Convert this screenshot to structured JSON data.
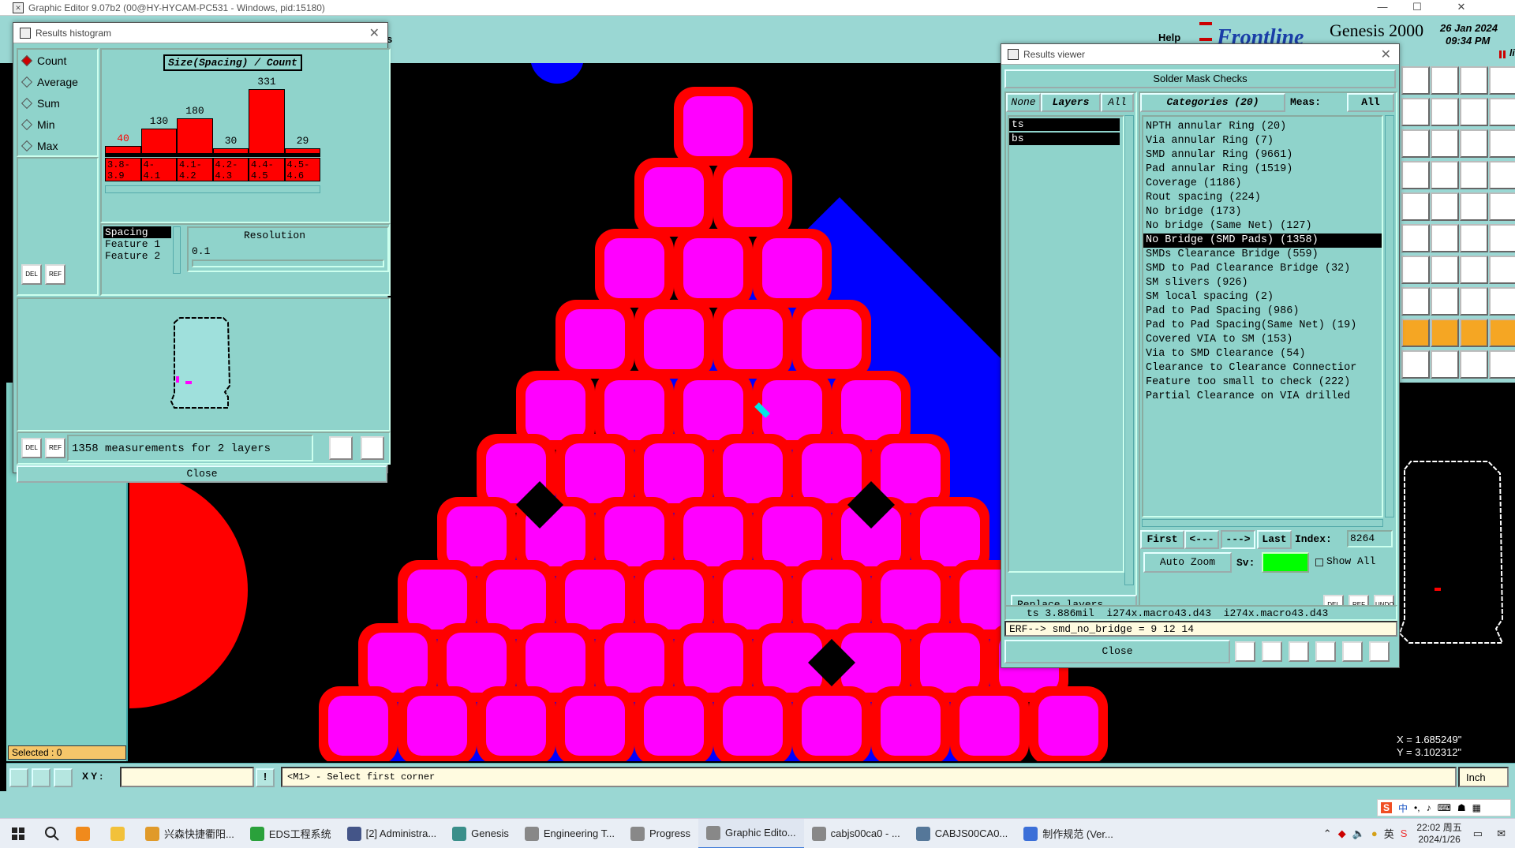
{
  "window": {
    "title": "Graphic Editor 9.07b2 (00@HY-HYCAM-PC531 - Windows, pid:15180)",
    "controls": [
      "—",
      "☐",
      "✕"
    ]
  },
  "brand": {
    "logo_text": "Frontline",
    "product": "Genesis 2000",
    "date": "26 Jan 2024",
    "time": "09:34 PM",
    "sub": "litor",
    "help": "Help"
  },
  "histogram": {
    "title": "Results histogram",
    "modes": [
      {
        "label": "Count",
        "selected": true
      },
      {
        "label": "Average",
        "selected": false
      },
      {
        "label": "Sum",
        "selected": false
      },
      {
        "label": "Min",
        "selected": false
      },
      {
        "label": "Max",
        "selected": false
      }
    ],
    "header": "Size(Spacing) / Count",
    "list_items": [
      "Spacing",
      "Feature 1",
      "Feature 2"
    ],
    "resolution_label": "Resolution",
    "resolution_value": "0.1",
    "summary": "1358 measurements for 2 layers",
    "close": "Close",
    "del": "DEL",
    "ref": "REF"
  },
  "chart_data": {
    "type": "bar",
    "title": "Size(Spacing) / Count",
    "categories": [
      "3.8-3.9",
      "4-4.1",
      "4.1-4.2",
      "4.2-4.3",
      "4.4-4.5",
      "4.5-4.6"
    ],
    "cat_top": [
      "3.8-",
      "4-",
      "4.1-",
      "4.2-",
      "4.4-",
      "4.5-"
    ],
    "cat_bottom": [
      "3.9",
      "4.1",
      "4.2",
      "4.3",
      "4.5",
      "4.6"
    ],
    "values": [
      40,
      130,
      180,
      30,
      331,
      29
    ],
    "value_colors": [
      "#ff0000",
      "#000000",
      "#000000",
      "#000000",
      "#000000",
      "#000000"
    ],
    "ylim": [
      0,
      331
    ],
    "bar_color": "#ff0000"
  },
  "viewer": {
    "title": "Results viewer",
    "header": "Solder Mask Checks",
    "layer_tabs": [
      "None",
      "Layers",
      "All"
    ],
    "layers": [
      "ts",
      "bs"
    ],
    "categories_label": "Categories (20)",
    "meas_label": "Meas:",
    "meas_value": "All",
    "categories": [
      "NPTH annular Ring (20)",
      "Via annular Ring (7)",
      "SMD annular Ring (9661)",
      "Pad annular Ring (1519)",
      "Coverage (1186)",
      "Rout spacing (224)",
      "No bridge (173)",
      "No bridge (Same Net) (127)",
      "No Bridge (SMD Pads) (1358)",
      "SMDs Clearance Bridge (559)",
      "SMD to Pad Clearance Bridge (32)",
      "SM slivers (926)",
      "SM local spacing (2)",
      "Pad to Pad Spacing (986)",
      "Pad to Pad Spacing(Same Net) (19)",
      "Covered VIA to SM (153)",
      "Via to SMD Clearance (54)",
      "Clearance to Clearance Connectior",
      "Feature too small to check (222)",
      "Partial Clearance on VIA drilled"
    ],
    "selected_index": 8,
    "nav": {
      "first": "First",
      "prev": "<---",
      "next": "--->",
      "last": "Last",
      "index_label": "Index:",
      "index_value": "8264"
    },
    "auto_zoom": "Auto Zoom",
    "sv_label": "Sv:",
    "show_all": "Show All",
    "replace_layers": "Replace layers",
    "del": "DEL",
    "ref": "REF",
    "undo": "UNDO",
    "info": "ts 3.886mil  i274x.macro43.d43  i274x.macro43.d43",
    "erf": "ERF--> smd_no_bridge = 9 12 14",
    "close": "Close"
  },
  "status": {
    "selected": "Selected : 0",
    "xy_label": "X Y :",
    "xy_value": "",
    "message": "<M1> - Select first corner",
    "unit": "Inch",
    "x": "X = 1.685249\"",
    "y": "Y = 3.102312\""
  },
  "taskbar": {
    "items": [
      {
        "label": "兴森快捷衢阳...",
        "color": "#e09a2a"
      },
      {
        "label": "EDS工程系统",
        "color": "#2aa13b"
      },
      {
        "label": "[2] Administra...",
        "color": "#445588"
      },
      {
        "label": "Genesis",
        "color": "#3a8f8a"
      },
      {
        "label": "Engineering T...",
        "color": "#888888"
      },
      {
        "label": "Progress",
        "color": "#888888"
      },
      {
        "label": "Graphic Edito...",
        "color": "#888888"
      },
      {
        "label": "cabjs00ca0 - ...",
        "color": "#888888"
      },
      {
        "label": "CABJS00CA0...",
        "color": "#557799"
      },
      {
        "label": "制作规范 (Ver...",
        "color": "#3b6fd8"
      }
    ],
    "active_index": 6,
    "clock_time": "22:02 周五",
    "clock_date": "2024/1/26",
    "ime": "英",
    "ime_cn": "中"
  },
  "colors": {
    "panel": "#8fd3cb",
    "pad_fill": "#ff00ff",
    "pad_outline": "#ff0000",
    "copper": "#0000ff",
    "highlight": "#00e5e5"
  }
}
